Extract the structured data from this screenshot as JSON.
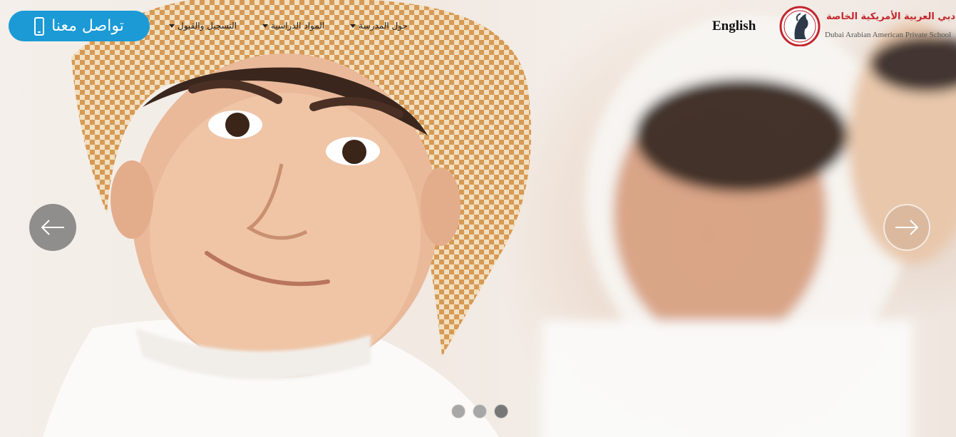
{
  "header": {
    "contact_label": "تواصل معنا",
    "contact_icon": "mobile-phone-icon",
    "accent_color": "#1b9ad6",
    "nav": [
      {
        "label": "حول المدرسة",
        "dropdown": true
      },
      {
        "label": "المواد الدراسية",
        "dropdown": true
      },
      {
        "label": "التسجيل والقبول",
        "dropdown": true
      }
    ],
    "language_label": "English",
    "logo": {
      "name_ar": "مدرسة دبي العربية الأمريكية الخاصة",
      "name_en": "Dubai Arabian American Private School",
      "emblem": "horse-head-emblem-icon",
      "color": "#c2272d"
    }
  },
  "carousel": {
    "prev_icon": "arrow-left-icon",
    "next_icon": "arrow-right-icon",
    "slide_count": 3,
    "active_index": 2
  }
}
